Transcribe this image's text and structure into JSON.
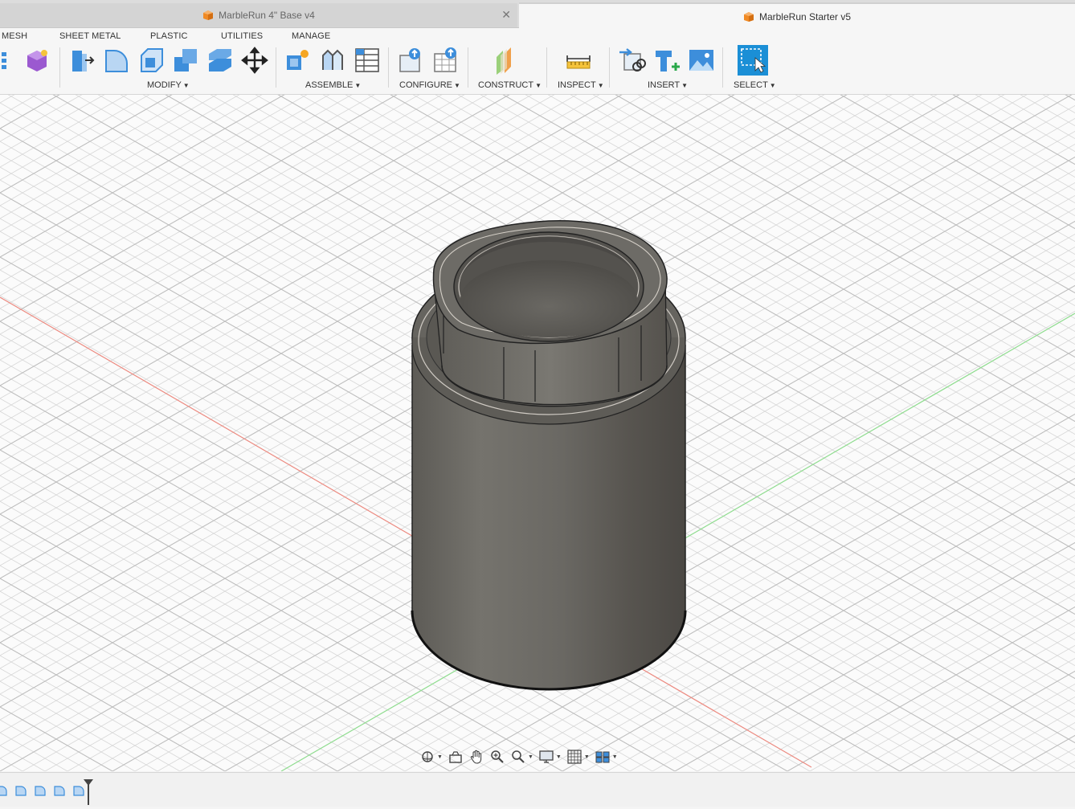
{
  "tabs": [
    {
      "label": "MarbleRun 4\" Base v4",
      "active": false
    },
    {
      "label": "MarbleRun Starter v5",
      "active": true
    }
  ],
  "workspace_tabs": [
    "MESH",
    "SHEET METAL",
    "PLASTIC",
    "UTILITIES",
    "MANAGE"
  ],
  "groups": {
    "modify": "MODIFY",
    "assemble": "ASSEMBLE",
    "configure": "CONFIGURE",
    "construct": "CONSTRUCT",
    "inspect": "INSPECT",
    "insert": "INSERT",
    "select": "SELECT"
  },
  "colors": {
    "accent_orange": "#f08a24",
    "select_blue": "#1b8fd6",
    "tool_blue": "#3d8edb",
    "x_axis": "#e8786e",
    "y_axis": "#7fd67f",
    "body_gray": "#6b6862"
  },
  "icons": {
    "nav": [
      "orbit-icon",
      "look-at-icon",
      "pan-icon",
      "zoom-icon",
      "fit-icon",
      "display-settings-icon",
      "grid-icon",
      "viewports-icon"
    ]
  },
  "timeline_items": 5
}
